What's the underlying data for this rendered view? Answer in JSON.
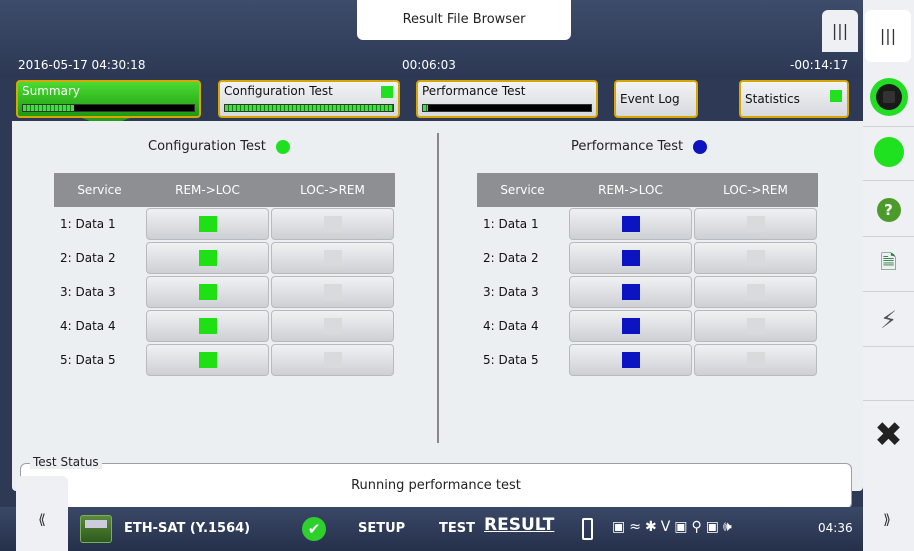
{
  "header": {
    "title": "Result File Browser",
    "datetime": "2016-05-17 04:30:18",
    "elapsed": "00:06:03",
    "remaining": "-00:14:17",
    "handle_glyph": "|||"
  },
  "tabs": [
    {
      "label": "Summary",
      "progress": 0.3,
      "active": true
    },
    {
      "label": "Configuration Test",
      "progress": 1.0,
      "status_color": "#20e020"
    },
    {
      "label": "Performance Test",
      "progress": 0.03
    },
    {
      "label": "Event Log"
    },
    {
      "label": "Statistics",
      "status_color": "#20e020"
    }
  ],
  "config_panel": {
    "title": "Configuration Test",
    "status_color": "#1fe01f",
    "columns": [
      "Service",
      "REM->LOC",
      "LOC->REM"
    ],
    "rows": [
      "1: Data 1",
      "2: Data 2",
      "3: Data 3",
      "4: Data 4",
      "5: Data 5"
    ],
    "indicator_color": "green"
  },
  "perf_panel": {
    "title": "Performance Test",
    "status_color": "#0b14c0",
    "columns": [
      "Service",
      "REM->LOC",
      "LOC->REM"
    ],
    "rows": [
      "1: Data 1",
      "2: Data 2",
      "3: Data 3",
      "4: Data 4",
      "5: Data 5"
    ],
    "indicator_color": "blue"
  },
  "test_status": {
    "legend": "Test Status",
    "text": "Running performance test"
  },
  "sidebar": {
    "icons": [
      "stop-button-icon",
      "status-led-icon",
      "help-icon",
      "report-icon",
      "lightning-icon",
      "close-icon"
    ],
    "help_glyph": "?",
    "close_glyph": "✖"
  },
  "bottom": {
    "app_name": "ETH-SAT (Y.1564)",
    "nav_setup": "SETUP",
    "nav_test": "TEST",
    "nav_result": "RESULT",
    "clock": "04:36",
    "left_handle": "⟪",
    "right_handle": "⟫"
  }
}
